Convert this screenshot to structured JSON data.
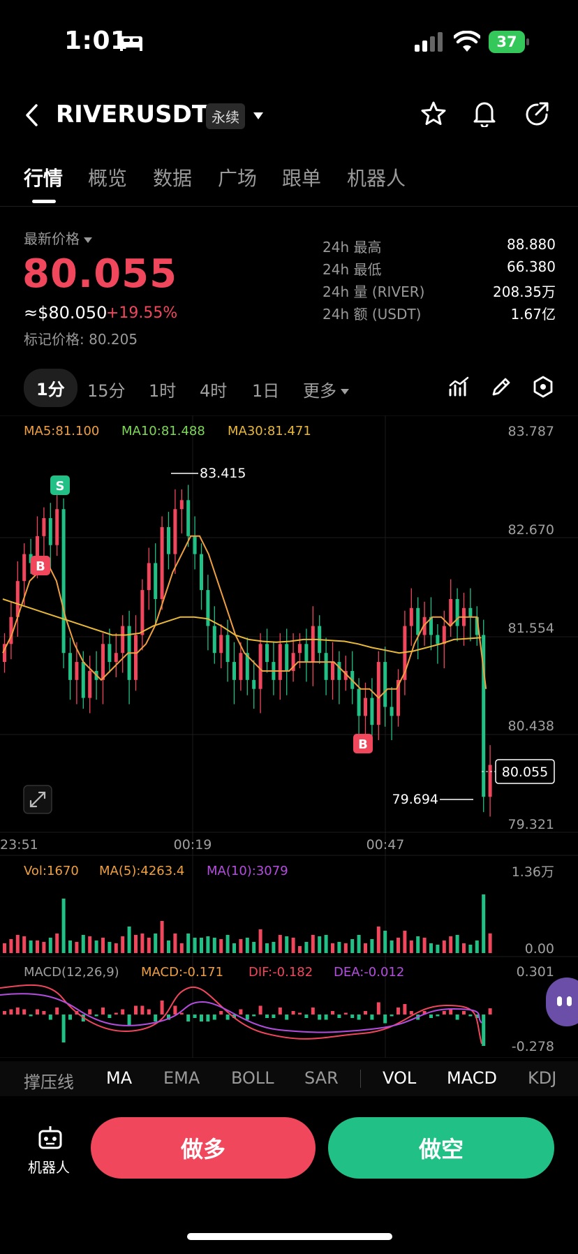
{
  "status_bar": {
    "time": "1:01",
    "battery": "37"
  },
  "header": {
    "pair": "RIVERUSDT",
    "contract_type": "永续"
  },
  "tabs": [
    {
      "label": "行情",
      "active": true
    },
    {
      "label": "概览"
    },
    {
      "label": "数据"
    },
    {
      "label": "广场"
    },
    {
      "label": "跟单"
    },
    {
      "label": "机器人"
    }
  ],
  "price": {
    "label": "最新价格",
    "last": "80.055",
    "usd": "≈$80.050",
    "change": "+19.55%",
    "mark": "标记价格: 80.205"
  },
  "stats": [
    {
      "label": "24h  最高",
      "value": "88.880"
    },
    {
      "label": "24h  最低",
      "value": "66.380"
    },
    {
      "label": "24h  量 (RIVER)",
      "value": "208.35万"
    },
    {
      "label": "24h  额 (USDT)",
      "value": "1.67亿"
    }
  ],
  "intervals": [
    "1分",
    "15分",
    "1时",
    "4时",
    "1日"
  ],
  "intervals_more": "更多",
  "chart": {
    "ma_legend": {
      "ma5": "MA5:81.100",
      "ma10": "MA10:81.488",
      "ma30": "MA30:81.471"
    },
    "price_axis": [
      "83.787",
      "82.670",
      "81.554",
      "80.438",
      "79.321"
    ],
    "time_axis": [
      "23:51",
      "00:19",
      "00:47"
    ],
    "high_marker": "83.415",
    "low_marker": "79.694",
    "current_price_tag": "80.055",
    "signal_sell": "S",
    "signal_buy": "B",
    "vol_legend": {
      "vol": "Vol:1670",
      "ma5": "MA(5):4263.4",
      "ma10": "MA(10):3079"
    },
    "vol_axis": [
      "1.36万",
      "0.00"
    ],
    "macd_legend": {
      "name": "MACD(12,26,9)",
      "macd": "MACD:-0.171",
      "dif": "DIF:-0.182",
      "dea": "DEA:-0.012"
    },
    "macd_axis": [
      "0.301",
      "-0.278"
    ]
  },
  "chart_data": {
    "type": "candlestick",
    "ylim": [
      79.321,
      83.787
    ],
    "closes": [
      81.4,
      81.7,
      82.1,
      82.4,
      82.3,
      82.6,
      82.8,
      82.5,
      82.9,
      81.3,
      81.0,
      81.2,
      80.8,
      81.1,
      81.0,
      81.4,
      81.2,
      81.3,
      81.6,
      81.0,
      81.5,
      82.0,
      82.3,
      81.9,
      82.7,
      82.4,
      82.9,
      83.0,
      82.6,
      82.4,
      82.0,
      81.6,
      81.3,
      81.5,
      81.2,
      81.0,
      81.3,
      81.0,
      80.9,
      81.4,
      81.2,
      81.0,
      81.4,
      81.1,
      81.3,
      81.4,
      81.2,
      81.6,
      81.3,
      81.0,
      81.2,
      81.0,
      81.1,
      80.9,
      80.6,
      80.8,
      80.5,
      81.2,
      80.7,
      80.6,
      81.0,
      81.6,
      81.8,
      81.5,
      81.7,
      81.5,
      81.4,
      81.6,
      81.9,
      81.6,
      81.8,
      81.7,
      81.5,
      79.7,
      80.055
    ],
    "ma5": [
      81.3,
      81.5,
      81.8,
      82.1,
      82.2,
      82.3,
      82.1,
      81.7,
      81.4,
      81.2,
      81.1,
      81.0,
      81.1,
      81.2,
      81.3,
      81.3,
      81.4,
      81.6,
      81.9,
      82.2,
      82.4,
      82.6,
      82.6,
      82.4,
      82.1,
      81.8,
      81.5,
      81.3,
      81.2,
      81.1,
      81.1,
      81.1,
      81.1,
      81.2,
      81.2,
      81.2,
      81.2,
      81.2,
      81.1,
      81.0,
      80.9,
      80.9,
      80.8,
      80.9,
      80.9,
      81.1,
      81.4,
      81.6,
      81.7,
      81.7,
      81.6,
      81.7,
      81.7,
      81.7,
      80.9
    ],
    "ma30": [
      81.9,
      81.85,
      81.8,
      81.75,
      81.7,
      81.65,
      81.6,
      81.55,
      81.5,
      81.5,
      81.52,
      81.6,
      81.65,
      81.7,
      81.7,
      81.68,
      81.6,
      81.5,
      81.45,
      81.43,
      81.42,
      81.43,
      81.45,
      81.45,
      81.44,
      81.43,
      81.4,
      81.36,
      81.33,
      81.3,
      81.32,
      81.36,
      81.4,
      81.45,
      81.46,
      81.47
    ],
    "volume_scale_max": "1.36万"
  },
  "indicators": [
    "撑压线",
    "MA",
    "EMA",
    "BOLL",
    "SAR",
    "VOL",
    "MACD",
    "KDJ"
  ],
  "bottom": {
    "robot_label": "机器人",
    "long_label": "做多",
    "short_label": "做空"
  },
  "colors": {
    "up": "#20c086",
    "down": "#f0475d",
    "ma5": "#f0a040",
    "ma10": "#7ed957",
    "ma30": "#e9b93a"
  }
}
